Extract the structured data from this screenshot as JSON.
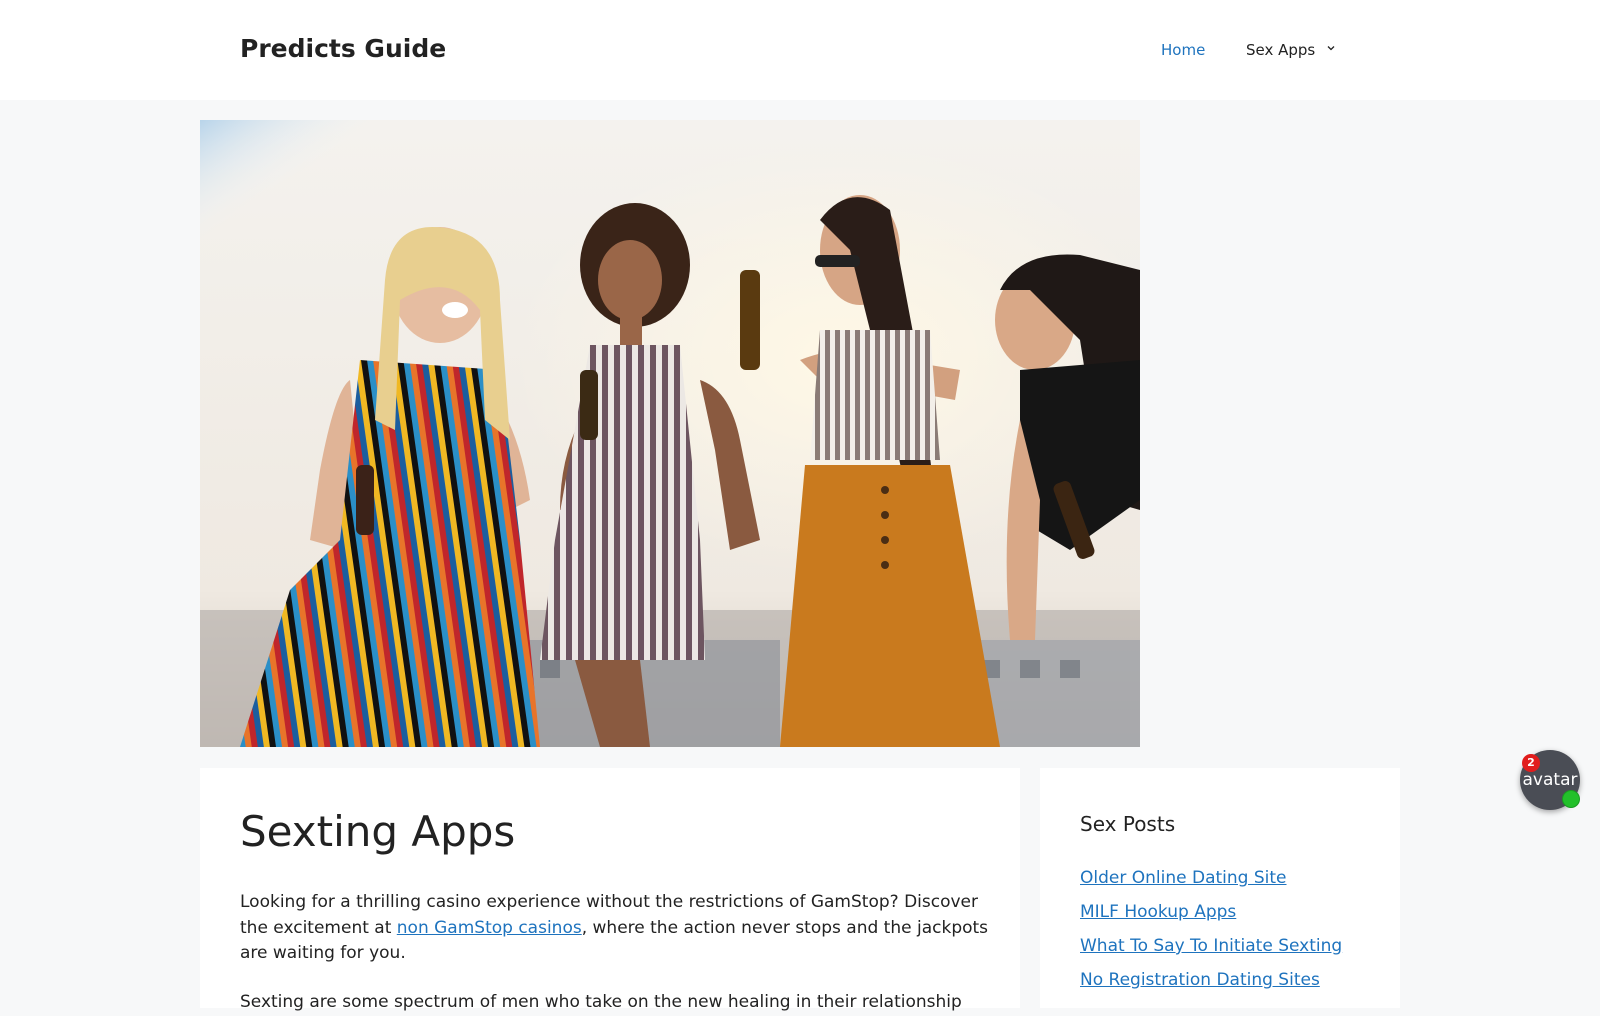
{
  "header": {
    "site_title": "Predicts Guide",
    "nav": [
      {
        "label": "Home",
        "color": "#1e73be",
        "active": true
      },
      {
        "label": "Sex Apps",
        "has_dropdown": true,
        "icon": "chevron-down-icon"
      }
    ]
  },
  "hero": {
    "image_description_icon": "hero-photo"
  },
  "article": {
    "title": "Sexting Apps",
    "paragraph_1_before": "Looking for a thrilling casino experience without the restrictions of GamStop? Discover the excitement at ",
    "paragraph_1_link": "non GamStop casinos",
    "paragraph_1_after": ", where the action never stops and the jackpots are waiting for you.",
    "paragraph_2": "Sexting are some spectrum of men who take on the new healing in their relationship"
  },
  "sidebar": {
    "widget_title": "Sex Posts",
    "links": [
      "Older Online Dating Site",
      "MILF Hookup Apps",
      "What To Say To Initiate Sexting",
      "No Registration Dating Sites"
    ]
  },
  "chat": {
    "label": "avatar",
    "badge_count": "2",
    "status_color": "#22c02a",
    "badge_color": "#e11d1d"
  },
  "colors": {
    "link": "#1e73be",
    "background": "#f7f8f9",
    "card": "#ffffff"
  }
}
